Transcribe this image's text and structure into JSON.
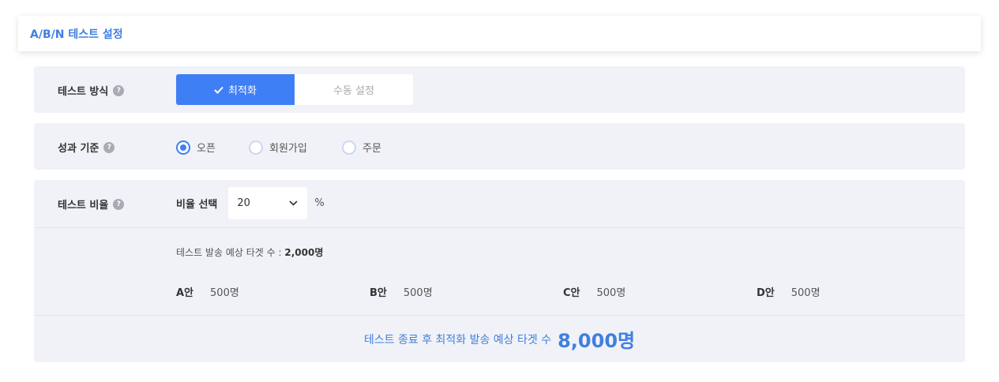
{
  "header": {
    "title": "A/B/N 테스트 설정"
  },
  "method": {
    "label": "테스트 방식",
    "options": [
      "최적화",
      "수동 설정"
    ],
    "selected": "최적화"
  },
  "criteria": {
    "label": "성과 기준",
    "options": [
      "오픈",
      "회원가입",
      "주문"
    ],
    "selected": "오픈"
  },
  "ratio": {
    "label": "테스트 비율",
    "select_label": "비율 선택",
    "select_value": "20",
    "unit": "%",
    "estimate_label": "테스트 발송 예상 타겟 수 :",
    "estimate_value": "2,000명",
    "variants": [
      {
        "name": "A안",
        "count": "500명"
      },
      {
        "name": "B안",
        "count": "500명"
      },
      {
        "name": "C안",
        "count": "500명"
      },
      {
        "name": "D안",
        "count": "500명"
      }
    ],
    "final_label": "테스트 종료 후 최적화 발송 예상 타겟 수",
    "final_value": "8,000명"
  },
  "icons": {
    "help": "question-icon",
    "check": "check-icon",
    "dropdown": "chevron-down-icon"
  },
  "colors": {
    "accent": "#3f7ff5",
    "title": "#3f7fe0",
    "row_bg": "#f1f2f7"
  }
}
